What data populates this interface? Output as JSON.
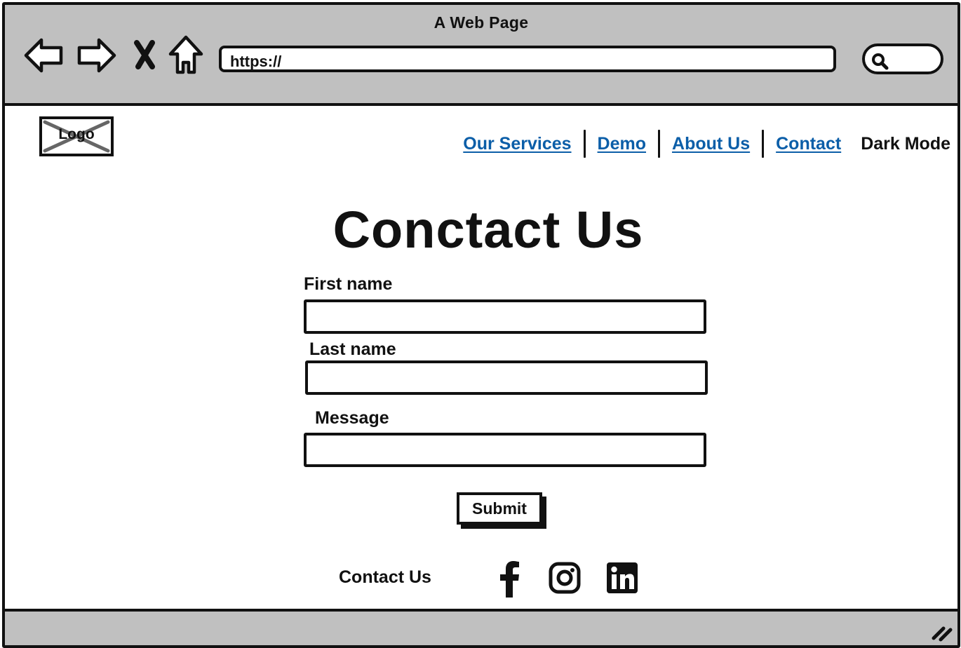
{
  "window": {
    "title": "A Web Page"
  },
  "browser": {
    "url": "https://",
    "back_icon": "back-arrow-icon",
    "forward_icon": "forward-arrow-icon",
    "stop_icon": "close-x-icon",
    "home_icon": "home-icon",
    "search_icon": "search-icon"
  },
  "header": {
    "logo_text": "Logo",
    "nav": [
      {
        "label": "Our Services"
      },
      {
        "label": "Demo"
      },
      {
        "label": "About Us"
      },
      {
        "label": "Contact"
      }
    ],
    "dark_mode_label": "Dark Mode"
  },
  "main": {
    "title": "Conctact Us",
    "form": {
      "first_name_label": "First name",
      "first_name_value": "",
      "last_name_label": "Last name",
      "last_name_value": "",
      "message_label": "Message",
      "message_value": "",
      "submit_label": "Submit"
    }
  },
  "footer": {
    "contact_text": "Contact Us",
    "social": [
      "facebook-icon",
      "instagram-icon",
      "linkedin-icon"
    ]
  },
  "colors": {
    "chrome": "#c0c0c0",
    "link": "#0b5ea8",
    "ink": "#111111",
    "logo_cross": "#666666"
  }
}
